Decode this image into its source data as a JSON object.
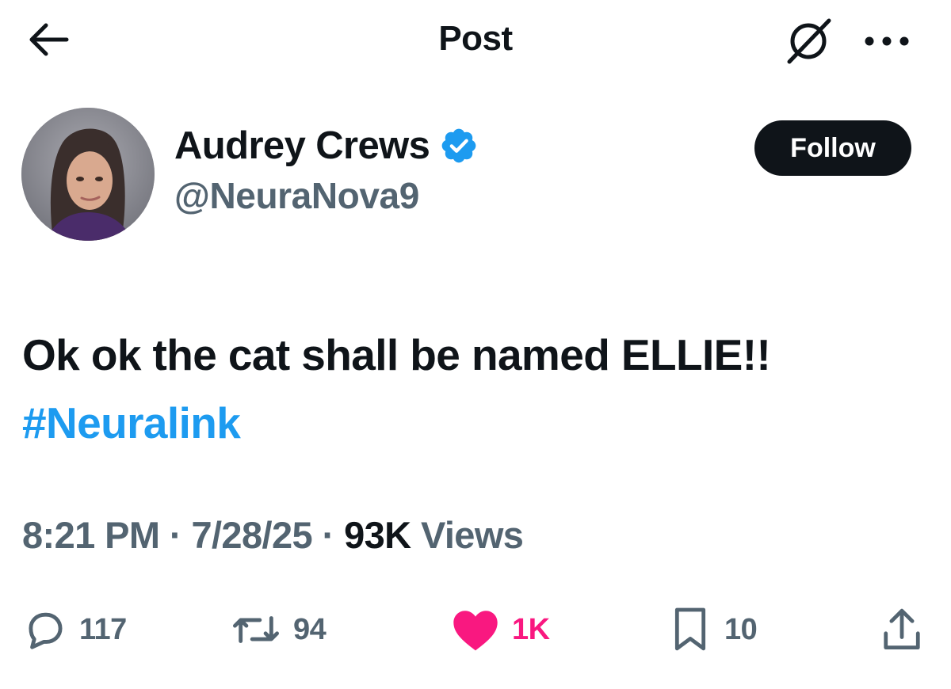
{
  "header": {
    "title": "Post",
    "back_icon": "arrow-left-icon",
    "grok_icon": "grok-icon",
    "more_icon": "more-dots-icon"
  },
  "author": {
    "display_name": "Audrey Crews",
    "handle": "@NeuraNova9",
    "verified": true,
    "verified_color": "#1d9bf0",
    "follow_label": "Follow"
  },
  "tweet": {
    "text_line1": "Ok ok the cat shall be named ELLIE!!",
    "hashtag": "#Neuralink",
    "time": "8:21 PM",
    "date": "7/28/25",
    "views_count": "93K",
    "views_label": "Views",
    "separator": "·"
  },
  "actions": {
    "replies": "117",
    "reposts": "94",
    "likes": "1K",
    "bookmarks": "10",
    "like_color": "#f91880",
    "icons": [
      "reply-icon",
      "repost-icon",
      "heart-icon",
      "bookmark-icon",
      "share-icon"
    ]
  }
}
